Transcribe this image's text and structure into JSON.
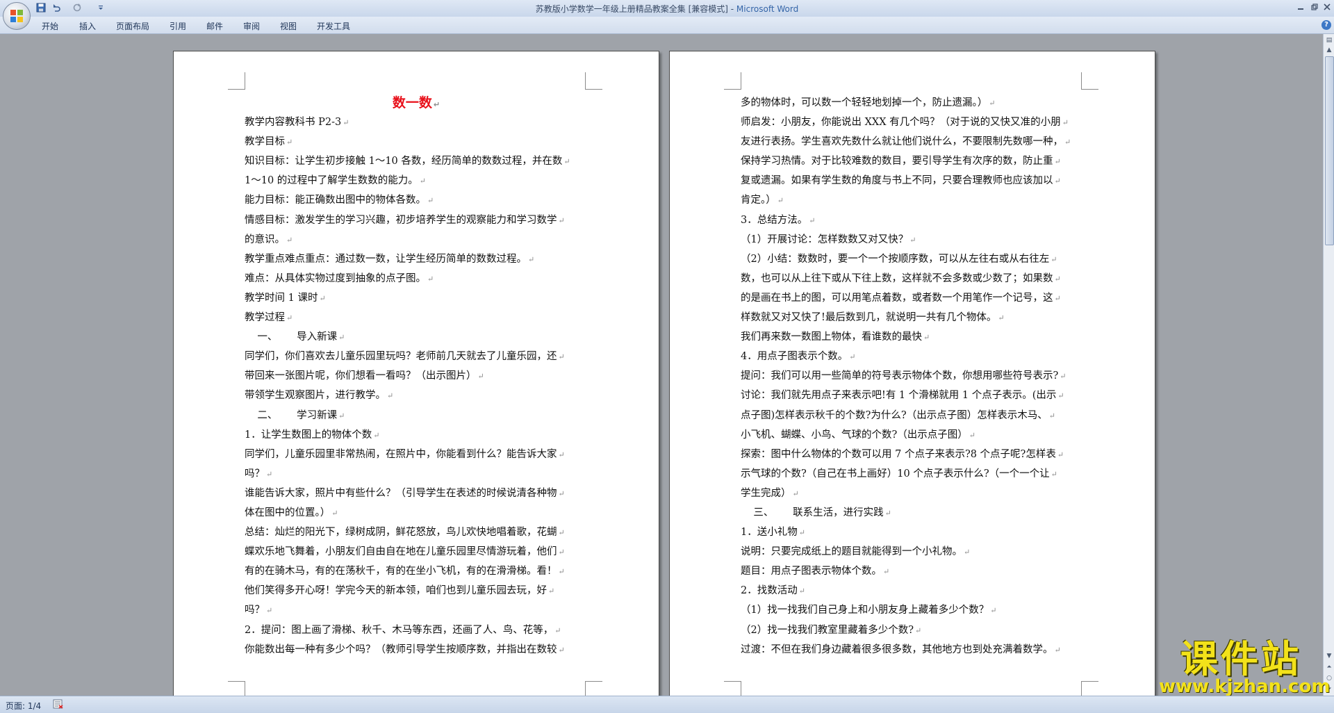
{
  "window": {
    "title": "苏教版小学数学一年级上册精品教案全集 [兼容模式] - ",
    "app_name": "Microsoft Word"
  },
  "ribbon": {
    "tabs": [
      "开始",
      "插入",
      "页面布局",
      "引用",
      "邮件",
      "审阅",
      "视图",
      "开发工具"
    ]
  },
  "document": {
    "title": "数一数",
    "left_lines": [
      "教学内容教科书 P2-3",
      "教学目标",
      "知识目标：让学生初步接触 1～10 各数，经历简单的数数过程，并在数",
      "1～10 的过程中了解学生数数的能力。",
      "能力目标：能正确数出图中的物体各数。",
      "情感目标：激发学生的学习兴趣，初步培养学生的观察能力和学习数学",
      "的意识。",
      "教学重点难点重点：通过数一数，让学生经历简单的数数过程。",
      "难点：从具体实物过度到抽象的点子图。",
      "教学时间 1 课时",
      "教学过程",
      "    一、      导入新课",
      "同学们，你们喜欢去儿童乐园里玩吗？老师前几天就去了儿童乐园，还",
      "带回来一张图片呢，你们想看一看吗？（出示图片）",
      "带领学生观察图片，进行教学。",
      "    二、      学习新课",
      "1．让学生数图上的物体个数",
      "同学们，儿童乐园里非常热闹，在照片中，你能看到什么？能告诉大家",
      "吗？",
      "谁能告诉大家，照片中有些什么？（引导学生在表述的时候说清各种物",
      "体在图中的位置。）",
      "总结：灿烂的阳光下，绿树成阴，鲜花怒放，鸟儿欢快地唱着歌，花蝴",
      "蝶欢乐地飞舞着，小朋友们自由自在地在儿童乐园里尽情游玩着，他们",
      "有的在骑木马，有的在荡秋千，有的在坐小飞机，有的在滑滑梯。看！",
      "他们笑得多开心呀！学完今天的新本领，咱们也到儿童乐园去玩，好",
      "吗？",
      "2．提问：图上画了滑梯、秋千、木马等东西，还画了人、鸟、花等，",
      "你能数出每一种有多少个吗？（教师引导学生按顺序数，并指出在数较"
    ],
    "right_lines": [
      "多的物体时，可以数一个轻轻地划掉一个，防止遗漏。）",
      "师启发：小朋友，你能说出 XXX 有几个吗？（对于说的又快又准的小朋",
      "友进行表扬。学生喜欢先数什么就让他们说什么，不要限制先数哪一种，",
      "保持学习热情。对于比较难数的数目，要引导学生有次序的数，防止重",
      "复或遗漏。如果有学生数的角度与书上不同，只要合理教师也应该加以",
      "肯定。）",
      "3．总结方法。",
      "（1）开展讨论：怎样数数又对又快？",
      "（2）小结：数数时，要一个一个按顺序数，可以从左往右或从右往左",
      "数，也可以从上往下或从下往上数，这样就不会多数或少数了；如果数",
      "的是画在书上的图，可以用笔点着数，或者数一个用笔作一个记号，这",
      "样数就又对又快了!最后数到几，就说明一共有几个物体。",
      "我们再来数一数图上物体，看谁数的最快",
      "4．用点子图表示个数。",
      "提问：我们可以用一些简单的符号表示物体个数，你想用哪些符号表示?",
      "讨论：我们就先用点子来表示吧!有 1 个滑梯就用 1 个点子表示。(出示",
      "点子图)怎样表示秋千的个数?为什么?（出示点子图）怎样表示木马、",
      "小飞机、蝴蝶、小鸟、气球的个数?（出示点子图）",
      "探索：图中什么物体的个数可以用 7 个点子来表示?8 个点子呢?怎样表",
      "示气球的个数?（自己在书上画好）10 个点子表示什么?（一个一个让",
      "学生完成）",
      "    三、      联系生活，进行实践",
      "1．送小礼物",
      "说明：只要完成纸上的题目就能得到一个小礼物。",
      "题目：用点子图表示物体个数。",
      "2．找数活动",
      "（1）找一找我们自己身上和小朋友身上藏着多少个数？",
      "（2）找一找我们教室里藏着多少个数?",
      "过渡：不但在我们身边藏着很多很多数，其他地方也到处充满着数学。"
    ]
  },
  "status_bar": {
    "page": "页面: 1/4"
  },
  "watermark": {
    "main": "课件站",
    "url": "www.kjzhan.com"
  }
}
